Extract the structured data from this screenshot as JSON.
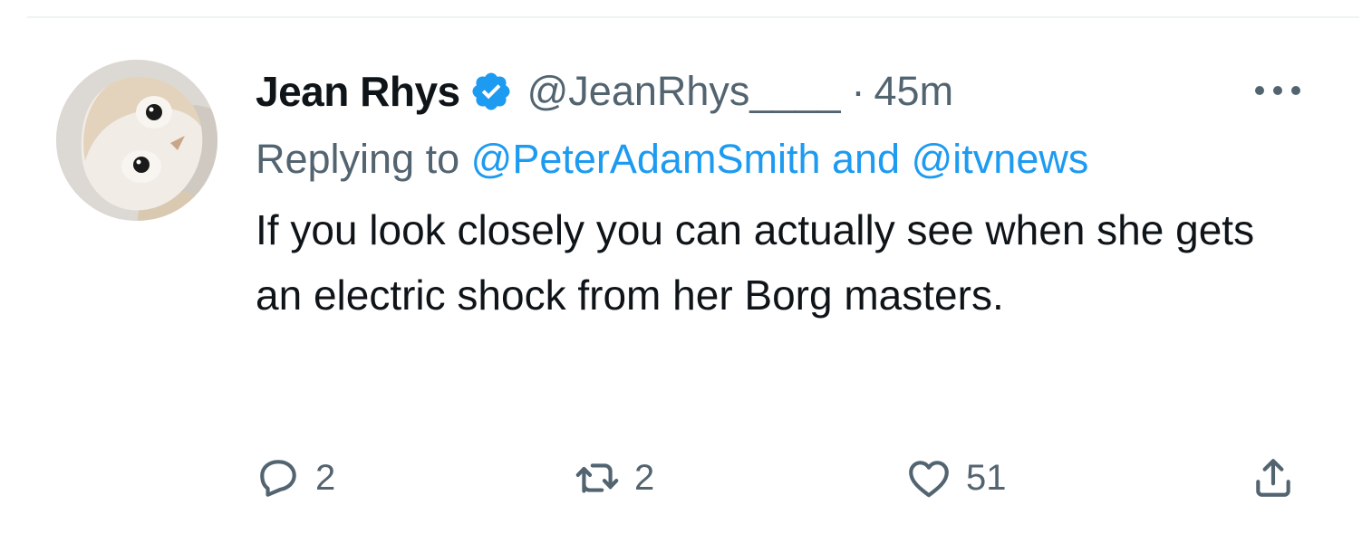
{
  "tweet": {
    "author": {
      "display_name": "Jean Rhys",
      "handle": "@JeanRhys____",
      "verified_color": "#1d9bf0"
    },
    "separator": "·",
    "time_ago": "45m",
    "reply_context": {
      "prefix": "Replying to",
      "mention_1": "@PeterAdamSmith",
      "joiner": "and",
      "mention_2": "@itvnews"
    },
    "text": "If you look closely you can actually see when she gets an electric shock from her Borg masters.",
    "stats": {
      "replies": "2",
      "retweets": "2",
      "likes": "51"
    },
    "icons": {
      "more": "more-horizontal-icon",
      "reply": "reply-icon",
      "retweet": "retweet-icon",
      "like": "heart-icon",
      "share": "share-icon",
      "verified": "verified-badge-icon"
    }
  },
  "colors": {
    "text_primary": "#0f1419",
    "text_secondary": "#536471",
    "accent": "#1d9bf0",
    "divider": "#eff3f4"
  }
}
